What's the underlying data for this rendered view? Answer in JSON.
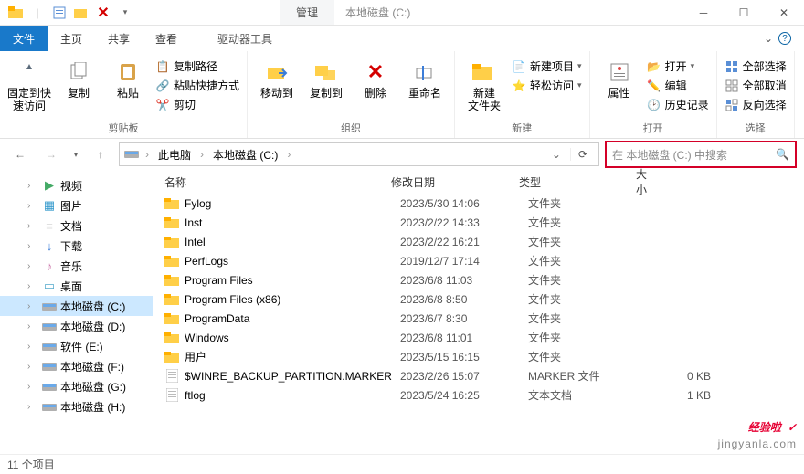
{
  "title": "本地磁盘 (C:)",
  "quick_access_toolbar": {
    "manage_tab": "管理"
  },
  "tabs": {
    "file": "文件",
    "home": "主页",
    "share": "共享",
    "view": "查看",
    "drive_tools": "驱动器工具"
  },
  "ribbon": {
    "group_clipboard": "剪贴板",
    "group_organize": "组织",
    "group_new": "新建",
    "group_open": "打开",
    "group_select": "选择",
    "pin": "固定到快\n速访问",
    "copy": "复制",
    "paste": "粘贴",
    "copy_path": "复制路径",
    "paste_shortcut": "粘贴快捷方式",
    "cut": "剪切",
    "move_to": "移动到",
    "copy_to": "复制到",
    "delete": "删除",
    "rename": "重命名",
    "new_folder": "新建\n文件夹",
    "new_item": "新建项目",
    "easy_access": "轻松访问",
    "properties": "属性",
    "open": "打开",
    "edit": "编辑",
    "history": "历史记录",
    "select_all": "全部选择",
    "select_none": "全部取消",
    "invert": "反向选择"
  },
  "breadcrumb": {
    "this_pc": "此电脑",
    "drive": "本地磁盘 (C:)"
  },
  "search_placeholder": "在 本地磁盘 (C:) 中搜索",
  "tree": [
    {
      "label": "视频",
      "icon": "video"
    },
    {
      "label": "图片",
      "icon": "pictures"
    },
    {
      "label": "文档",
      "icon": "documents"
    },
    {
      "label": "下载",
      "icon": "downloads"
    },
    {
      "label": "音乐",
      "icon": "music"
    },
    {
      "label": "桌面",
      "icon": "desktop"
    },
    {
      "label": "本地磁盘 (C:)",
      "icon": "disk",
      "selected": true
    },
    {
      "label": "本地磁盘 (D:)",
      "icon": "disk"
    },
    {
      "label": "软件 (E:)",
      "icon": "disk"
    },
    {
      "label": "本地磁盘 (F:)",
      "icon": "disk"
    },
    {
      "label": "本地磁盘 (G:)",
      "icon": "disk"
    },
    {
      "label": "本地磁盘 (H:)",
      "icon": "disk"
    }
  ],
  "columns": {
    "name": "名称",
    "date": "修改日期",
    "type": "类型",
    "size": "大小"
  },
  "files": [
    {
      "name": "Fylog",
      "date": "2023/5/30 14:06",
      "type": "文件夹",
      "size": "",
      "kind": "folder"
    },
    {
      "name": "Inst",
      "date": "2023/2/22 14:33",
      "type": "文件夹",
      "size": "",
      "kind": "folder"
    },
    {
      "name": "Intel",
      "date": "2023/2/22 16:21",
      "type": "文件夹",
      "size": "",
      "kind": "folder"
    },
    {
      "name": "PerfLogs",
      "date": "2019/12/7 17:14",
      "type": "文件夹",
      "size": "",
      "kind": "folder"
    },
    {
      "name": "Program Files",
      "date": "2023/6/8 11:03",
      "type": "文件夹",
      "size": "",
      "kind": "folder"
    },
    {
      "name": "Program Files (x86)",
      "date": "2023/6/8 8:50",
      "type": "文件夹",
      "size": "",
      "kind": "folder"
    },
    {
      "name": "ProgramData",
      "date": "2023/6/7 8:30",
      "type": "文件夹",
      "size": "",
      "kind": "folder"
    },
    {
      "name": "Windows",
      "date": "2023/6/8 11:01",
      "type": "文件夹",
      "size": "",
      "kind": "folder"
    },
    {
      "name": "用户",
      "date": "2023/5/15 16:15",
      "type": "文件夹",
      "size": "",
      "kind": "folder"
    },
    {
      "name": "$WINRE_BACKUP_PARTITION.MARKER",
      "date": "2023/2/26 15:07",
      "type": "MARKER 文件",
      "size": "0 KB",
      "kind": "file"
    },
    {
      "name": "ftlog",
      "date": "2023/5/24 16:25",
      "type": "文本文档",
      "size": "1 KB",
      "kind": "file"
    }
  ],
  "status": "11 个项目",
  "watermark": {
    "big": "经验啦",
    "url": "jingyanla.com"
  }
}
